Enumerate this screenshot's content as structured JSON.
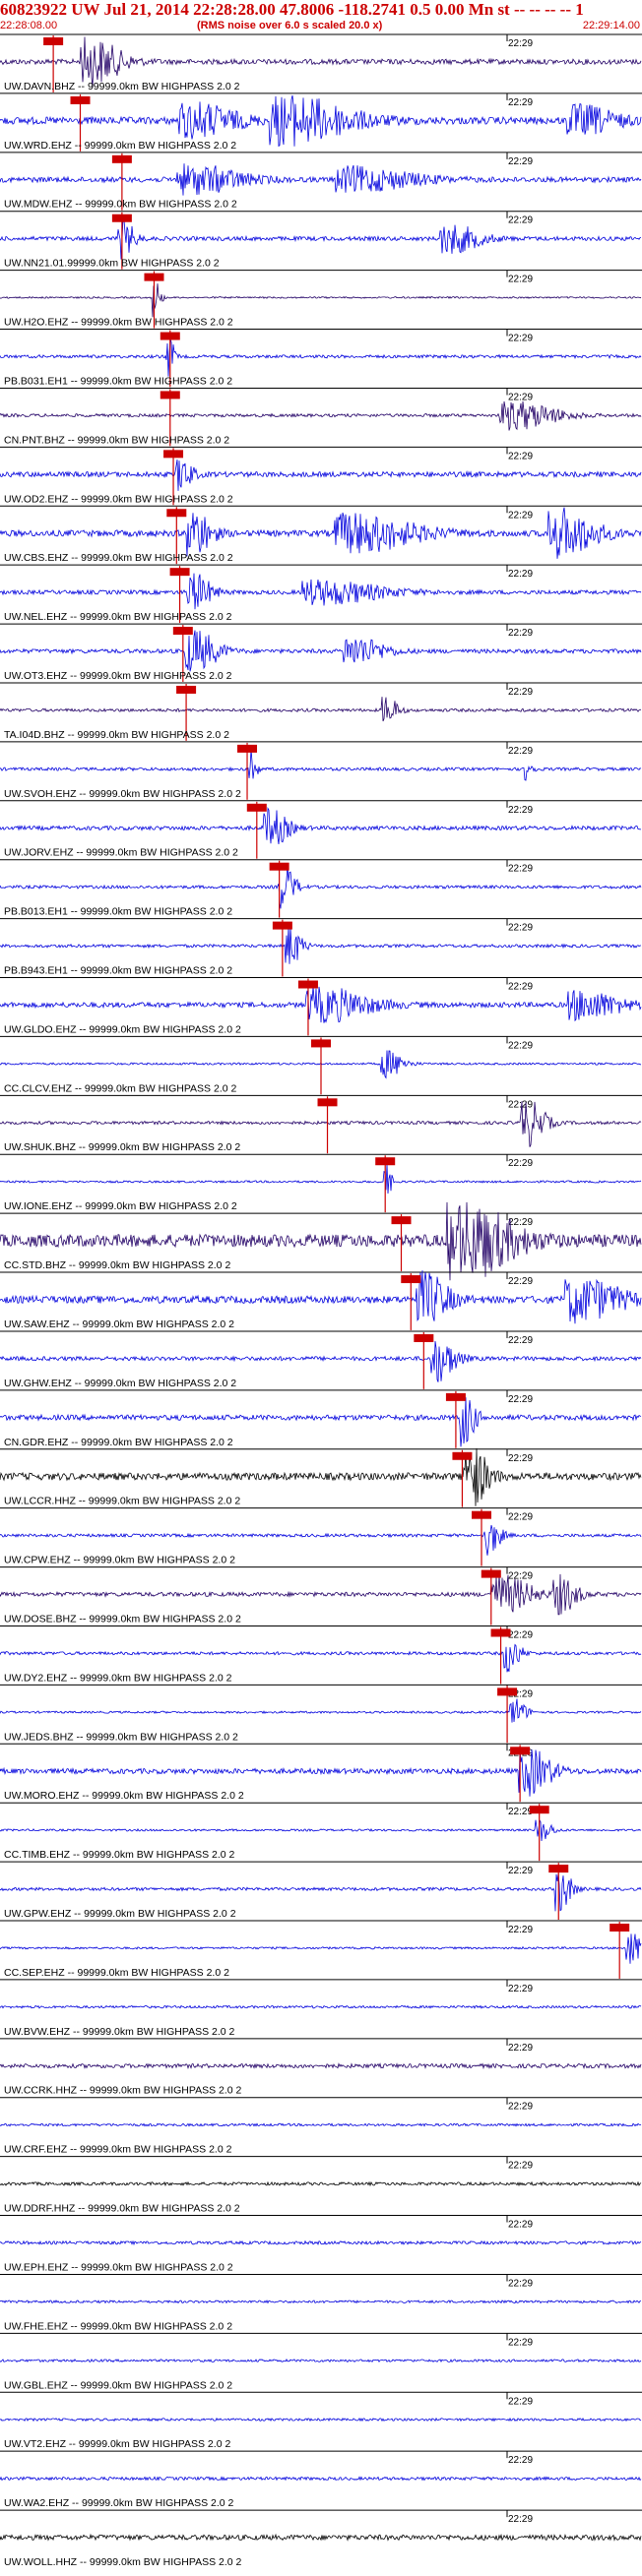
{
  "header": {
    "title": "60823922 UW Jul 21, 2014 22:28:28.00   47.8006 -118.2741  0.5 0.00 Mn st -- -- -- -- 1",
    "start_time": "22:28:08.00",
    "rms_note": "(RMS noise over 6.0 s scaled 20.0 x)",
    "end_time": "22:29:14.00"
  },
  "tick_label": "22:29",
  "colors": {
    "red": "#cc0000",
    "blue": "#0000dd",
    "navy": "#220066",
    "black": "#000000"
  },
  "traces": [
    {
      "label": "UW.DAVN.BHZ -- 99999.0km BW  HIGHPASS  2.0  2",
      "color": "navy",
      "pick": 0.083,
      "amp": 0.25,
      "events": [
        [
          0.14,
          0.05,
          1.0
        ]
      ]
    },
    {
      "label": "UW.WRD.EHZ -- 99999.0km BW  HIGHPASS  2.0  2",
      "color": "blue",
      "pick": 0.125,
      "amp": 0.35,
      "events": [
        [
          0.45,
          0.1,
          1.0
        ],
        [
          0.3,
          0.07,
          0.7
        ],
        [
          0.9,
          0.06,
          0.6
        ]
      ]
    },
    {
      "label": "UW.MDW.EHZ -- 99999.0km BW  HIGHPASS  2.0  2",
      "color": "blue",
      "pick": 0.19,
      "amp": 0.25,
      "events": [
        [
          0.3,
          0.08,
          0.6
        ],
        [
          0.55,
          0.1,
          0.5
        ]
      ]
    },
    {
      "label": "UW.NN21.01.99999.0km BW  HIGHPASS  2.0  2",
      "color": "blue",
      "pick": 0.19,
      "amp": 0.2,
      "events": [
        [
          0.19,
          0.02,
          0.8
        ],
        [
          0.7,
          0.05,
          0.6
        ]
      ]
    },
    {
      "label": "UW.H2O.EHZ -- 99999.0km BW  HIGHPASS  2.0  2",
      "color": "navy",
      "pick": 0.24,
      "amp": 0.08,
      "events": [
        [
          0.24,
          0.01,
          0.9
        ]
      ]
    },
    {
      "label": "PB.B031.EH1 -- 99999.0km BW  HIGHPASS  2.0  2",
      "color": "blue",
      "pick": 0.265,
      "amp": 0.15,
      "events": [
        [
          0.26,
          0.01,
          1.2
        ]
      ]
    },
    {
      "label": "CN.PNT.BHZ -- 99999.0km BW  HIGHPASS  2.0  2",
      "color": "navy",
      "pick": 0.265,
      "amp": 0.15,
      "events": [
        [
          0.8,
          0.07,
          0.6
        ]
      ]
    },
    {
      "label": "UW.OD2.EHZ -- 99999.0km BW  HIGHPASS  2.0  2",
      "color": "blue",
      "pick": 0.27,
      "amp": 0.25,
      "events": [
        [
          0.28,
          0.02,
          0.7
        ]
      ]
    },
    {
      "label": "UW.CBS.EHZ -- 99999.0km BW  HIGHPASS  2.0  2",
      "color": "blue",
      "pick": 0.275,
      "amp": 0.3,
      "events": [
        [
          0.3,
          0.03,
          1.0
        ],
        [
          0.55,
          0.1,
          0.8
        ],
        [
          0.87,
          0.06,
          1.0
        ]
      ]
    },
    {
      "label": "UW.NEL.EHZ -- 99999.0km BW  HIGHPASS  2.0  2",
      "color": "blue",
      "pick": 0.28,
      "amp": 0.2,
      "events": [
        [
          0.3,
          0.03,
          0.8
        ],
        [
          0.5,
          0.1,
          0.5
        ]
      ]
    },
    {
      "label": "UW.OT3.EHZ -- 99999.0km BW  HIGHPASS  2.0  2",
      "color": "blue",
      "pick": 0.285,
      "amp": 0.2,
      "events": [
        [
          0.3,
          0.04,
          0.9
        ],
        [
          0.55,
          0.05,
          0.6
        ]
      ]
    },
    {
      "label": "TA.I04D.BHZ -- 99999.0km BW  HIGHPASS  2.0  2",
      "color": "navy",
      "pick": 0.29,
      "amp": 0.15,
      "events": [
        [
          0.6,
          0.02,
          0.6
        ]
      ]
    },
    {
      "label": "UW.SVOH.EHZ -- 99999.0km BW  HIGHPASS  2.0  2",
      "color": "blue",
      "pick": 0.385,
      "amp": 0.15,
      "events": [
        [
          0.39,
          0.01,
          0.8
        ],
        [
          0.82,
          0.01,
          0.5
        ]
      ]
    },
    {
      "label": "UW.JORV.EHZ -- 99999.0km BW  HIGHPASS  2.0  2",
      "color": "blue",
      "pick": 0.4,
      "amp": 0.2,
      "events": [
        [
          0.42,
          0.03,
          0.8
        ]
      ]
    },
    {
      "label": "PB.B013.EH1 -- 99999.0km BW  HIGHPASS  2.0  2",
      "color": "blue",
      "pick": 0.435,
      "amp": 0.15,
      "events": [
        [
          0.44,
          0.02,
          1.0
        ]
      ]
    },
    {
      "label": "PB.B943.EH1 -- 99999.0km BW  HIGHPASS  2.0  2",
      "color": "blue",
      "pick": 0.44,
      "amp": 0.15,
      "events": [
        [
          0.45,
          0.02,
          0.9
        ]
      ]
    },
    {
      "label": "UW.GLDO.EHZ -- 99999.0km BW  HIGHPASS  2.0  2",
      "color": "blue",
      "pick": 0.48,
      "amp": 0.25,
      "events": [
        [
          0.5,
          0.08,
          0.7
        ],
        [
          0.9,
          0.07,
          0.6
        ]
      ]
    },
    {
      "label": "CC.CLCV.EHZ -- 99999.0km BW  HIGHPASS  2.0  2",
      "color": "blue",
      "pick": 0.5,
      "amp": 0.1,
      "events": [
        [
          0.6,
          0.03,
          0.6
        ]
      ]
    },
    {
      "label": "UW.SHUK.BHZ -- 99999.0km BW  HIGHPASS  2.0  2",
      "color": "navy",
      "pick": 0.51,
      "amp": 0.15,
      "events": [
        [
          0.82,
          0.03,
          1.0
        ]
      ]
    },
    {
      "label": "UW.IONE.EHZ -- 99999.0km BW  HIGHPASS  2.0  2",
      "color": "blue",
      "pick": 0.6,
      "amp": 0.1,
      "events": [
        [
          0.6,
          0.01,
          0.8
        ]
      ]
    },
    {
      "label": "CC.STD.BHZ -- 99999.0km BW  HIGHPASS  2.0  2",
      "color": "navy",
      "pick": 0.625,
      "amp": 0.6,
      "events": [
        [
          0.72,
          0.08,
          1.6
        ]
      ]
    },
    {
      "label": "UW.SAW.EHZ -- 99999.0km BW  HIGHPASS  2.0  2",
      "color": "blue",
      "pick": 0.64,
      "amp": 0.35,
      "events": [
        [
          0.66,
          0.04,
          1.1
        ],
        [
          0.9,
          0.07,
          0.9
        ]
      ]
    },
    {
      "label": "UW.GHW.EHZ -- 99999.0km BW  HIGHPASS  2.0  2",
      "color": "blue",
      "pick": 0.66,
      "amp": 0.2,
      "events": [
        [
          0.68,
          0.03,
          1.0
        ]
      ]
    },
    {
      "label": "CN.GDR.EHZ -- 99999.0km BW  HIGHPASS  2.0  2",
      "color": "blue",
      "pick": 0.71,
      "amp": 0.25,
      "events": [
        [
          0.72,
          0.02,
          1.2
        ]
      ]
    },
    {
      "label": "UW.LCCR.HHZ -- 99999.0km BW  HIGHPASS  2.0  2",
      "color": "black",
      "pick": 0.72,
      "amp": 0.35,
      "events": [
        [
          0.73,
          0.03,
          1.4
        ]
      ]
    },
    {
      "label": "UW.CPW.EHZ -- 99999.0km BW  HIGHPASS  2.0  2",
      "color": "blue",
      "pick": 0.75,
      "amp": 0.15,
      "events": [
        [
          0.76,
          0.02,
          0.8
        ]
      ]
    },
    {
      "label": "UW.DOSE.BHZ -- 99999.0km BW  HIGHPASS  2.0  2",
      "color": "navy",
      "pick": 0.765,
      "amp": 0.2,
      "events": [
        [
          0.78,
          0.05,
          0.8
        ],
        [
          0.87,
          0.03,
          0.8
        ]
      ]
    },
    {
      "label": "UW.DY2.EHZ -- 99999.0km BW  HIGHPASS  2.0  2",
      "color": "blue",
      "pick": 0.78,
      "amp": 0.15,
      "events": [
        [
          0.79,
          0.02,
          0.8
        ]
      ]
    },
    {
      "label": "UW.JEDS.BHZ -- 99999.0km BW  HIGHPASS  2.0  2",
      "color": "blue",
      "pick": 0.79,
      "amp": 0.1,
      "events": [
        [
          0.8,
          0.02,
          0.6
        ]
      ]
    },
    {
      "label": "UW.MORO.EHZ -- 99999.0km BW  HIGHPASS  2.0  2",
      "color": "blue",
      "pick": 0.81,
      "amp": 0.25,
      "events": [
        [
          0.82,
          0.04,
          1.0
        ]
      ]
    },
    {
      "label": "CC.TIMB.EHZ -- 99999.0km BW  HIGHPASS  2.0  2",
      "color": "blue",
      "pick": 0.84,
      "amp": 0.1,
      "events": [
        [
          0.84,
          0.02,
          0.5
        ]
      ]
    },
    {
      "label": "UW.GPW.EHZ -- 99999.0km BW  HIGHPASS  2.0  2",
      "color": "blue",
      "pick": 0.87,
      "amp": 0.15,
      "events": [
        [
          0.87,
          0.02,
          1.0
        ]
      ]
    },
    {
      "label": "CC.SEP.EHZ -- 99999.0km BW  HIGHPASS  2.0  2",
      "color": "blue",
      "pick": 0.965,
      "amp": 0.1,
      "events": [
        [
          0.98,
          0.02,
          0.8
        ]
      ]
    },
    {
      "label": "UW.BVW.EHZ -- 99999.0km BW  HIGHPASS  2.0  2",
      "color": "blue",
      "pick": null,
      "amp": 0.12,
      "events": []
    },
    {
      "label": "UW.CCRK.HHZ -- 99999.0km BW  HIGHPASS  2.0  2",
      "color": "navy",
      "pick": null,
      "amp": 0.2,
      "events": []
    },
    {
      "label": "UW.CRF.EHZ -- 99999.0km BW  HIGHPASS  2.0  2",
      "color": "blue",
      "pick": null,
      "amp": 0.12,
      "events": []
    },
    {
      "label": "UW.DDRF.HHZ -- 99999.0km BW  HIGHPASS  2.0  2",
      "color": "black",
      "pick": null,
      "amp": 0.15,
      "events": []
    },
    {
      "label": "UW.EPH.EHZ -- 99999.0km BW  HIGHPASS  2.0  2",
      "color": "blue",
      "pick": null,
      "amp": 0.15,
      "events": []
    },
    {
      "label": "UW.FHE.EHZ -- 99999.0km BW  HIGHPASS  2.0  2",
      "color": "blue",
      "pick": null,
      "amp": 0.12,
      "events": []
    },
    {
      "label": "UW.GBL.EHZ -- 99999.0km BW  HIGHPASS  2.0  2",
      "color": "blue",
      "pick": null,
      "amp": 0.12,
      "events": []
    },
    {
      "label": "UW.VT2.EHZ -- 99999.0km BW  HIGHPASS  2.0  2",
      "color": "blue",
      "pick": null,
      "amp": 0.12,
      "events": []
    },
    {
      "label": "UW.WA2.EHZ -- 99999.0km BW  HIGHPASS  2.0  2",
      "color": "blue",
      "pick": null,
      "amp": 0.15,
      "events": []
    },
    {
      "label": "UW.WOLL.HHZ -- 99999.0km BW  HIGHPASS  2.0  2",
      "color": "black",
      "pick": null,
      "amp": 0.25,
      "events": []
    }
  ]
}
